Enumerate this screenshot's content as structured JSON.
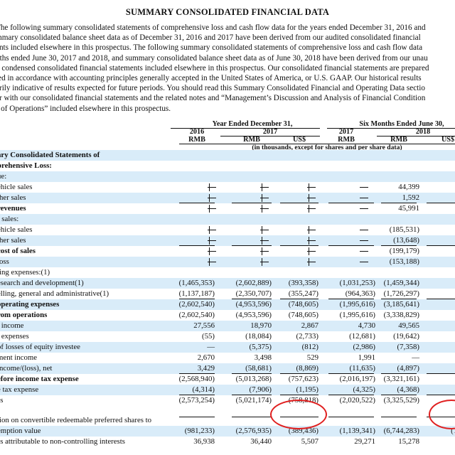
{
  "title": "SUMMARY CONSOLIDATED FINANCIAL DATA",
  "intro_lines": [
    "The following summary consolidated statements of comprehensive loss and cash flow data for the years ended December 31, 2016 and",
    "mmary consolidated balance sheet data as of December 31, 2016 and 2017 have been derived from our audited consolidated financial",
    "ents included elsewhere in this prospectus. The following summary consolidated statements of comprehensive loss and cash flow data",
    "nths ended June 30, 2017 and 2018, and summary consolidated balance sheet data as of June 30, 2018 have been derived from our unau",
    "n condensed consolidated financial statements included elsewhere in this prospectus. Our consolidated financial statements are prepared",
    "ted in accordance with accounting principles generally accepted in the United States of America, or U.S. GAAP. Our historical results",
    "arily indicative of results expected for future periods. You should read this Summary Consolidated Financial and Operating Data sectio",
    "er with our consolidated financial statements and the related notes and “Management’s Discussion and Analysis of Financial Condition",
    "s of Operations” included elsewhere in this prospectus."
  ],
  "header": {
    "group1": "Year Ended December 31,",
    "group2": "Six Months Ended June 30,",
    "year_2016": "2016",
    "year_2017": "2017",
    "year_2017b": "2017",
    "year_2018": "2018",
    "cols": [
      "RMB",
      "RMB",
      "US$",
      "RMB",
      "RMB",
      "US$"
    ],
    "units_note": "(in thousands, except for shares and per share data)"
  },
  "rows": [
    {
      "label": "ary Consolidated Statements of",
      "bold": true,
      "vals": []
    },
    {
      "label": "prehensive Loss:",
      "bold": true,
      "vals": []
    },
    {
      "label": "ue:",
      "vals": []
    },
    {
      "label": "ehicle sales",
      "vals": [
        "",
        "",
        "",
        "",
        "44,399",
        "6"
      ],
      "dashes": true
    },
    {
      "label": "ther sales",
      "vals": [
        "",
        "",
        "",
        "",
        "1,592",
        ""
      ],
      "dashes": true
    },
    {
      "label": "revenues",
      "bold": true,
      "vals": [
        "",
        "",
        "",
        "",
        "45,991",
        "6"
      ],
      "dashes": true
    },
    {
      "label": "f sales:",
      "vals": []
    },
    {
      "label": "ehicle sales",
      "vals": [
        "",
        "",
        "",
        "",
        "(185,531)",
        "(28"
      ],
      "dashes": true
    },
    {
      "label": "ther sales",
      "vals": [
        "",
        "",
        "",
        "",
        "(13,648)",
        "(2"
      ],
      "dashes": true
    },
    {
      "label": "cost of sales",
      "bold": true,
      "vals": [
        "",
        "",
        "",
        "",
        "(199,179)",
        "(30"
      ],
      "dashes": true
    },
    {
      "label": "loss",
      "vals": [
        "",
        "",
        "",
        "",
        "(153,188)",
        "(23"
      ],
      "dashes": true
    },
    {
      "label": "ting expenses:(1)",
      "vals": []
    },
    {
      "label": "esearch and development(1)",
      "vals": [
        "(1,465,353)",
        "(2,602,889)",
        "(393,358)",
        "(1,031,253)",
        "(1,459,344)",
        "(220"
      ]
    },
    {
      "label": "elling, general and administrative(1)",
      "vals": [
        "(1,137,187)",
        "(2,350,707)",
        "(355,247)",
        "(964,363)",
        "(1,726,297)",
        "(260"
      ]
    },
    {
      "label": "operating expenses",
      "bold": true,
      "vals": [
        "(2,602,540)",
        "(4,953,596)",
        "(748,605)",
        "(1,995,616)",
        "(3,185,641)",
        "(481"
      ]
    },
    {
      "label": "rom operations",
      "bold": true,
      "vals": [
        "(2,602,540)",
        "(4,953,596)",
        "(748,605)",
        "(1,995,616)",
        "(3,338,829)",
        "(504"
      ]
    },
    {
      "label": "t income",
      "vals": [
        "27,556",
        "18,970",
        "2,867",
        "4,730",
        "49,565",
        "7"
      ]
    },
    {
      "label": "t expenses",
      "vals": [
        "(55)",
        "(18,084)",
        "(2,733)",
        "(12,681)",
        "(19,642)",
        "(2"
      ]
    },
    {
      "label": "of losses of equity investee",
      "vals": [
        "—",
        "(5,375)",
        "(812)",
        "(2,986)",
        "(7,358)",
        "(1"
      ]
    },
    {
      "label": "ment income",
      "vals": [
        "2,670",
        "3,498",
        "529",
        "1,991",
        "—",
        ""
      ]
    },
    {
      "label": "income/(loss), net",
      "vals": [
        "3,429",
        "(58,681)",
        "(8,869)",
        "(11,635)",
        "(4,897)",
        ""
      ]
    },
    {
      "label": "efore income tax expense",
      "bold": true,
      "vals": [
        "(2,568,940)",
        "(5,013,268)",
        "(757,623)",
        "(2,016,197)",
        "(3,321,161)",
        "(501"
      ]
    },
    {
      "label": "e tax expense",
      "vals": [
        "(4,314)",
        "(7,906)",
        "(1,195)",
        "(4,325)",
        "(4,368)",
        ""
      ]
    },
    {
      "label": "ss",
      "vals": [
        "(2,573,254)",
        "(5,021,174)",
        "(758,818)",
        "(2,020,522)",
        "(3,325,529)",
        "(502"
      ]
    },
    {
      "label": "",
      "vals": []
    },
    {
      "label": "tion on convertible redeemable preferred shares to",
      "vals": []
    },
    {
      "label": "emption value",
      "vals": [
        "(981,233)",
        "(2,576,935)",
        "(389,436)",
        "(1,139,341)",
        "(6,744,283)",
        "(1,019"
      ]
    },
    {
      "label": "ss attributable to non-controlling interests",
      "vals": [
        "36,938",
        "36,440",
        "5,507",
        "29,271",
        "15,278",
        "2"
      ]
    }
  ]
}
